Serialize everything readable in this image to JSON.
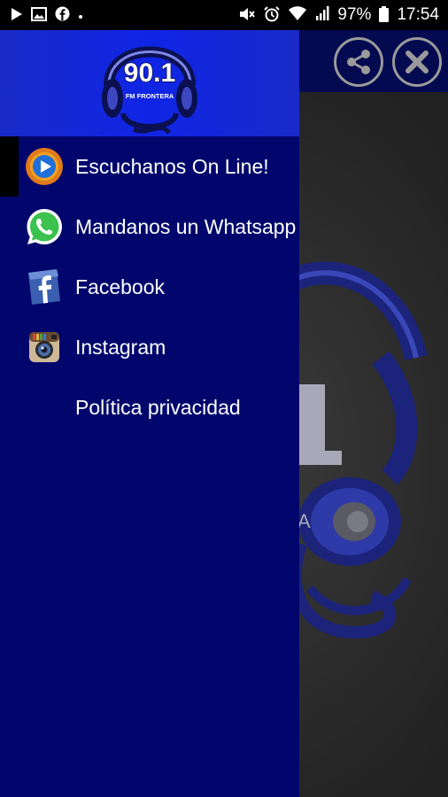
{
  "status_bar": {
    "battery": "97%",
    "time": "17:54",
    "icons_left": [
      "play-icon",
      "image-icon",
      "facebook-icon",
      "dot-icon"
    ],
    "icons_right": [
      "mute-icon",
      "alarm-icon",
      "wifi-icon",
      "signal-icon",
      "battery-icon"
    ]
  },
  "drawer": {
    "logo": {
      "number": "90.1",
      "subtitle": "FM FRONTERA"
    },
    "items": [
      {
        "label": "Escuchanos On Line!",
        "icon": "play-circle-icon",
        "active": true
      },
      {
        "label": "Mandanos un Whatsapp",
        "icon": "whatsapp-icon",
        "active": false
      },
      {
        "label": "Facebook",
        "icon": "facebook-icon",
        "active": false
      },
      {
        "label": "Instagram",
        "icon": "instagram-icon",
        "active": false
      },
      {
        "label": "Política privacidad",
        "icon": "",
        "active": false
      }
    ]
  },
  "toolbar": {
    "buttons": [
      "share-icon",
      "close-icon"
    ]
  },
  "colors": {
    "drawer_bg": "#00066c",
    "header_bg": "#0f25e6",
    "toolbar_bg": "#040a50"
  }
}
